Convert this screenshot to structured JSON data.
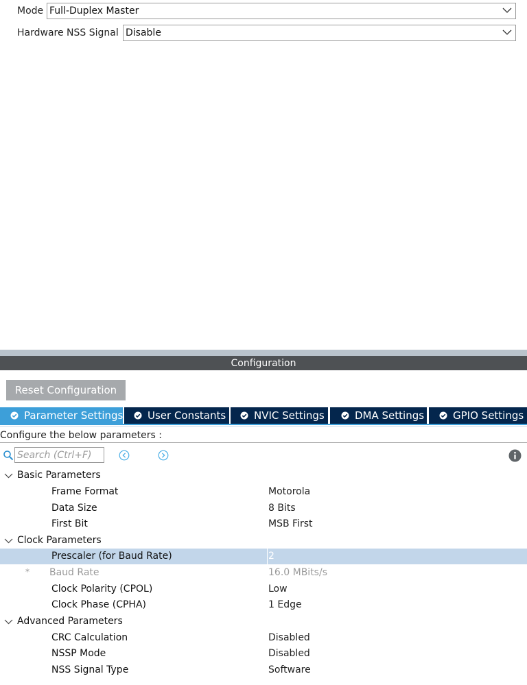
{
  "mode_section": {
    "mode": {
      "label": "Mode",
      "value": "Full-Duplex Master"
    },
    "nss": {
      "label": "Hardware NSS Signal",
      "value": "Disable"
    }
  },
  "configuration": {
    "title": "Configuration",
    "reset_label": "Reset Configuration",
    "tabs": [
      {
        "label": "Parameter Settings",
        "icon": "check-circle-icon",
        "active": true
      },
      {
        "label": "User Constants",
        "icon": "check-circle-icon",
        "active": false
      },
      {
        "label": "NVIC Settings",
        "icon": "check-circle-icon",
        "active": false
      },
      {
        "label": "DMA Settings",
        "icon": "check-circle-icon",
        "active": false
      },
      {
        "label": "GPIO Settings",
        "icon": "check-circle-icon",
        "active": false
      }
    ],
    "hint": "Configure the below parameters :",
    "search_placeholder": "Search (Ctrl+F)"
  },
  "parameters": {
    "basic": {
      "label": "Basic Parameters",
      "items": [
        {
          "name": "Frame Format",
          "value": "Motorola"
        },
        {
          "name": "Data Size",
          "value": "8 Bits"
        },
        {
          "name": "First Bit",
          "value": "MSB First"
        }
      ]
    },
    "clock": {
      "label": "Clock Parameters",
      "items": [
        {
          "name": "Prescaler (for Baud Rate)",
          "value": "2",
          "selected": true
        },
        {
          "name": "Baud Rate",
          "value": "16.0 MBits/s",
          "readonly": true,
          "marker": "*"
        },
        {
          "name": "Clock Polarity (CPOL)",
          "value": "Low"
        },
        {
          "name": "Clock Phase (CPHA)",
          "value": "1 Edge"
        }
      ]
    },
    "advanced": {
      "label": "Advanced Parameters",
      "items": [
        {
          "name": "CRC Calculation",
          "value": "Disabled"
        },
        {
          "name": "NSSP Mode",
          "value": "Disabled"
        },
        {
          "name": "NSS Signal Type",
          "value": "Software"
        }
      ]
    }
  },
  "colors": {
    "tab_active": "#3d9fd9",
    "tab_inactive": "#04264d",
    "header_bar": "#4e5154",
    "selected_row": "#c2d6ea",
    "reset_button": "#a6a9ac"
  }
}
